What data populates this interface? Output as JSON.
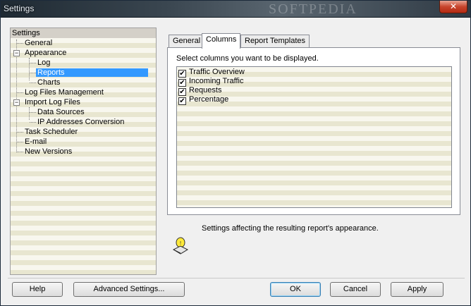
{
  "window": {
    "title": "Settings",
    "watermark": "SOFTPEDIA",
    "close_glyph": "✕"
  },
  "tree": {
    "root": "Settings",
    "items": [
      {
        "label": "General"
      },
      {
        "label": "Appearance",
        "expander": "−"
      },
      {
        "label": "Log"
      },
      {
        "label": "Reports"
      },
      {
        "label": "Charts"
      },
      {
        "label": "Log Files Management"
      },
      {
        "label": "Import Log Files",
        "expander": "−"
      },
      {
        "label": "Data Sources"
      },
      {
        "label": "IP Addresses Conversion"
      },
      {
        "label": "Task Scheduler"
      },
      {
        "label": "E-mail"
      },
      {
        "label": "New Versions"
      }
    ]
  },
  "tabs": [
    {
      "label": "General"
    },
    {
      "label": "Columns"
    },
    {
      "label": "Report Templates"
    }
  ],
  "panel": {
    "description": "Select columns you want to be displayed.",
    "check_glyph": "✔",
    "columns": [
      {
        "label": "Traffic Overview"
      },
      {
        "label": "Incoming Traffic"
      },
      {
        "label": "Requests"
      },
      {
        "label": "Percentage"
      }
    ]
  },
  "info": {
    "text": "Settings affecting the resulting report's appearance."
  },
  "buttons": {
    "help": "Help",
    "advanced": "Advanced Settings...",
    "ok": "OK",
    "cancel": "Cancel",
    "apply": "Apply"
  },
  "colors": {
    "selection": "#3399ff",
    "row_alt": "#e8e6d0",
    "row_base": "#f8f7ee"
  }
}
